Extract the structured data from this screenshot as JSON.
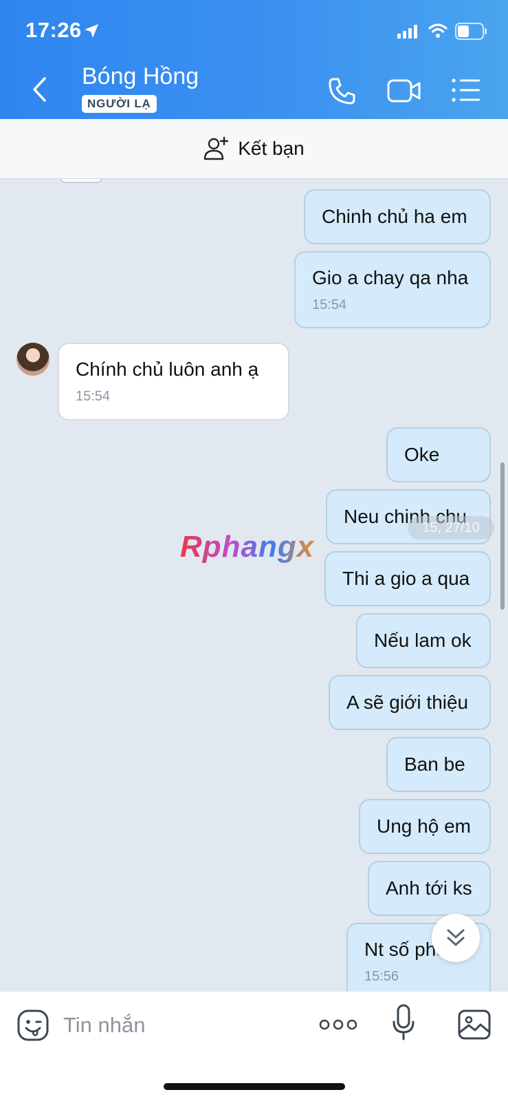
{
  "status_bar": {
    "time": "17:26"
  },
  "header": {
    "contact_name": "Bóng Hồng",
    "badge": "NGƯỜI LẠ"
  },
  "friend_bar": {
    "label": "Kết bạn"
  },
  "messages": [
    {
      "dir": "out",
      "text": "Chinh chủ ha em",
      "time": ""
    },
    {
      "dir": "out",
      "text": "Gio a chay qa nha",
      "time": "15:54"
    },
    {
      "dir": "in",
      "text": "Chính chủ luôn anh ạ",
      "time": "15:54"
    },
    {
      "dir": "out",
      "text": "Oke",
      "time": ""
    },
    {
      "dir": "out",
      "text": "Neu chinh chu",
      "time": ""
    },
    {
      "dir": "out",
      "text": "Thi a gio a qua",
      "time": ""
    },
    {
      "dir": "out",
      "text": "Nếu lam ok",
      "time": ""
    },
    {
      "dir": "out",
      "text": "A sẽ giới thiệu",
      "time": ""
    },
    {
      "dir": "out",
      "text": "Ban be",
      "time": ""
    },
    {
      "dir": "out",
      "text": "Ung hộ em",
      "time": ""
    },
    {
      "dir": "out",
      "text": "Anh tới ks",
      "time": ""
    },
    {
      "dir": "out",
      "text": "Nt số phòng",
      "time": "15:56"
    }
  ],
  "date_chip": "15, 27/10",
  "watermark": "Rphangx",
  "composer": {
    "placeholder": "Tin nhắn"
  },
  "colors": {
    "header_start": "#2f86ef",
    "header_end": "#4aa4ee",
    "outgoing_bubble": "#d5ebfb",
    "chat_bg": "#e2e8f0"
  },
  "icons": [
    "location-arrow-icon",
    "signal-icon",
    "wifi-icon",
    "battery-icon",
    "back-icon",
    "phone-icon",
    "video-icon",
    "menu-list-icon",
    "add-friend-icon",
    "chevron-double-down-icon",
    "sticker-icon",
    "more-dots-icon",
    "mic-icon",
    "image-icon"
  ]
}
